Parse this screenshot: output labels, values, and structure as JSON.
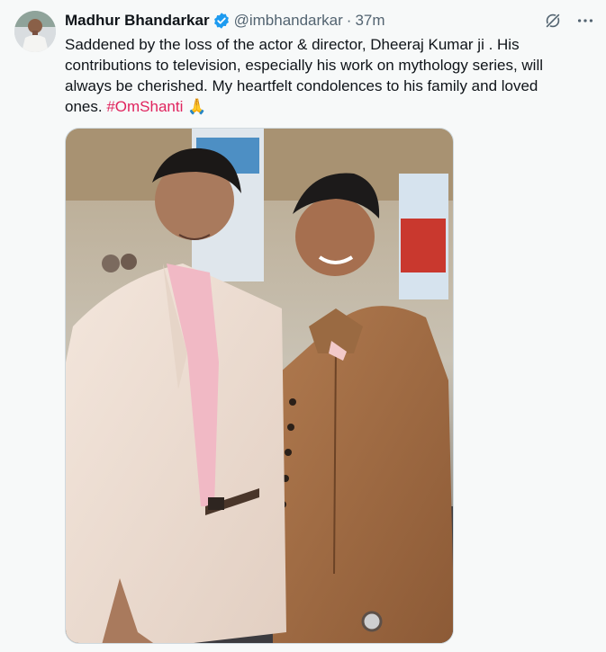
{
  "tweet": {
    "author_name": "Madhur Bhandarkar",
    "handle": "@imbhandarkar",
    "separator": "·",
    "time": "37m",
    "text": "Saddened by the loss of the actor & director, Dheeraj Kumar ji . His contributions to television, especially his work on mythology series, will always be cherished. My heartfelt condolences to his family and loved ones.",
    "hashtag": "#OmShanti",
    "emoji": "🙏"
  },
  "icons": {
    "verified": "verified-badge-icon",
    "grok": "grok-icon",
    "more": "more-icon"
  },
  "colors": {
    "verified": "#1d9bf0",
    "hashtag": "#e0245e",
    "secondary_text": "#536471"
  }
}
